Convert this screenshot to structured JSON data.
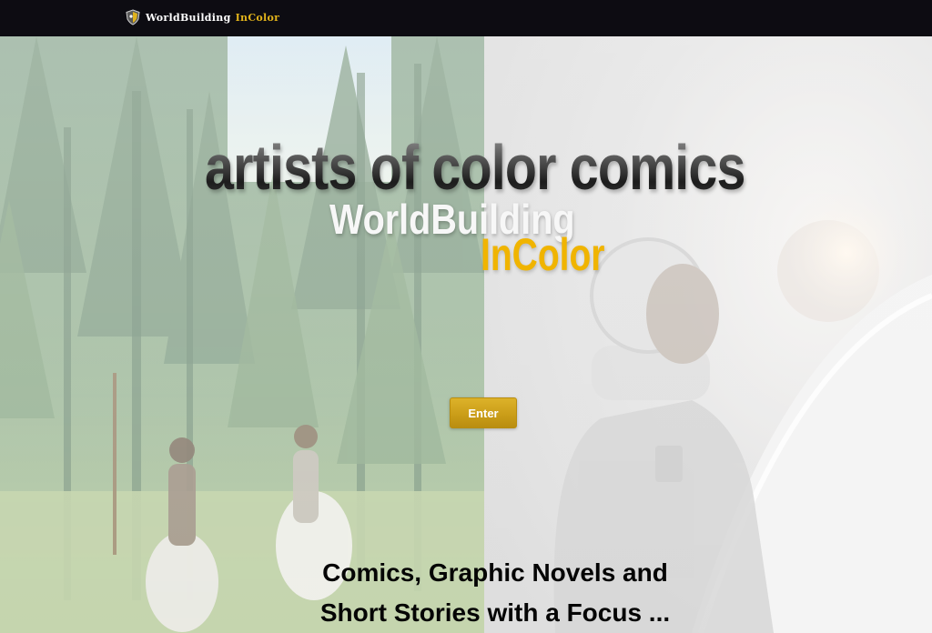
{
  "header": {
    "brand_main": "WorldBuilding",
    "brand_accent": "InColor",
    "logo_icon": "shield-logo-icon"
  },
  "hero": {
    "headline": "artists of color comics",
    "subtitle_main": "WorldBuilding",
    "subtitle_accent": "InColor",
    "enter_label": "Enter",
    "tagline_line1": "Comics, Graphic Novels and",
    "tagline_line2": "Short Stories with a Focus ..."
  },
  "colors": {
    "topbar": "#0d0c12",
    "accent_gold": "#f0b400",
    "button_gold": "#c99c17",
    "headline_dark": "#1d1d1d"
  }
}
